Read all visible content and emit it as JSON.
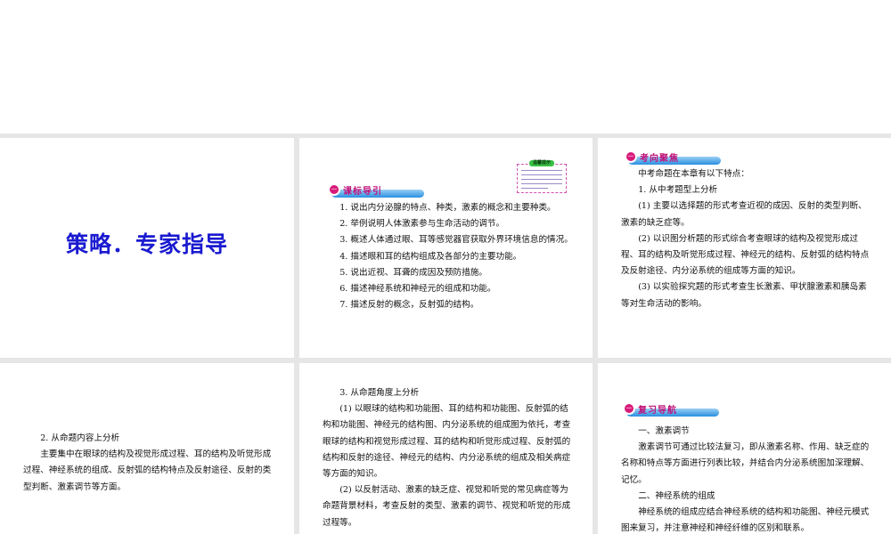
{
  "slides": [
    {
      "title": "策略．专家指导"
    },
    {
      "badge": "课标导引",
      "tip_title": "温馨提示",
      "lines": [
        "1. 说出内分泌腺的特点、种类，激素的概念和主要种类。",
        "2. 举例说明人体激素参与生命活动的调节。",
        "3. 概述人体通过眼、耳等感觉器官获取外界环境信息的情况。",
        "4. 描述眼和耳的结构组成及各部分的主要功能。",
        "5. 说出近视、耳聋的成因及预防措施。",
        "6. 描述神经系统和神经元的组成和功能。",
        "7. 描述反射的概念，反射弧的结构。"
      ]
    },
    {
      "badge": "考向聚焦",
      "lines": [
        "中考命题在本章有以下特点：",
        "1. 从中考题型上分析",
        "(1) 主要以选择题的形式考查近视的成因、反射的类型判断、激素的缺乏症等。",
        "(2) 以识图分析题的形式综合考查眼球的结构及视觉形成过程、耳的结构及听觉形成过程、神经元的结构、反射弧的结构特点及反射途径、内分泌系统的组成等方面的知识。",
        "(3) 以实验探究题的形式考查生长激素、甲状腺激素和胰岛素等对生命活动的影响。"
      ]
    },
    {
      "lines": [
        "2. 从命题内容上分析",
        "主要集中在眼球的结构及视觉形成过程、耳的结构及听觉形成过程、神经系统的组成、反射弧的结构特点及反射途径、反射的类型判断、激素调节等方面。"
      ]
    },
    {
      "lines": [
        "3. 从命题角度上分析",
        "(1) 以眼球的结构和功能图、耳的结构和功能图、反射弧的结构和功能图、神经元的结构图、内分泌系统的组成图为依托，考查眼球的结构和视觉形成过程、耳的结构和听觉形成过程、反射弧的结构和反射的途径、神经元的结构、内分泌系统的组成及相关病症等方面的知识。",
        "(2) 以反射活动、激素的缺乏症、视觉和听觉的常见病症等为命题背景材料，考查反射的类型、激素的调节、视觉和听觉的形成过程等。"
      ]
    },
    {
      "badge": "复习导航",
      "lines": [
        "一、激素调节",
        "激素调节可通过比较法复习，即从激素名称、作用、缺乏症的名称和特点等方面进行列表比较，并结合内分泌系统图加深理解、记忆。",
        "二、神经系统的组成",
        "神经系统的组成应结合神经系统的结构和功能图、神经元模式图来复习，并注意神经和神经纤维的区别和联系。"
      ]
    }
  ]
}
